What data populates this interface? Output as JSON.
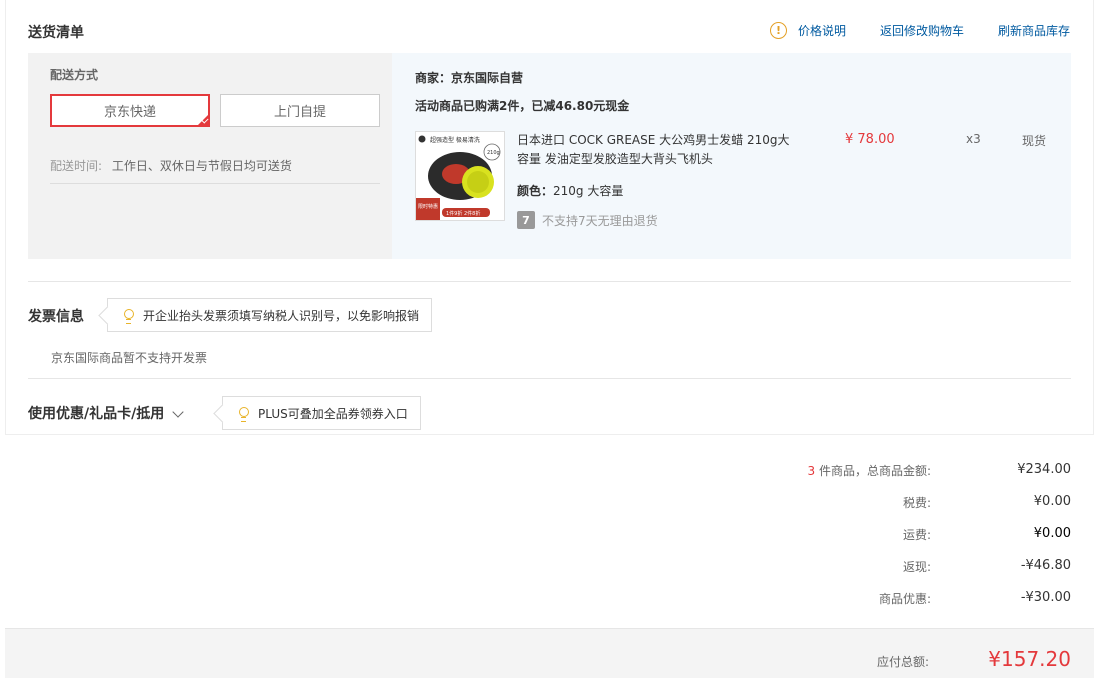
{
  "shipping": {
    "title": "送货清单",
    "links": {
      "price_note": "价格说明",
      "back_to_cart": "返回修改购物车",
      "refresh_stock": "刷新商品库存"
    },
    "delivery_method_label": "配送方式",
    "options": [
      "京东快递",
      "上门自提"
    ],
    "selected_option": "京东快递",
    "delivery_time_label": "配送时间:",
    "delivery_time_value": "工作日、双休日与节假日均可送货"
  },
  "order": {
    "merchant": "商家：京东国际自营",
    "promo": "活动商品已购满2件，已减46.80元现金",
    "product": {
      "name": "日本进口 COCK GREASE 大公鸡男士发蜡 210g大容量 发油定型发胶造型大背头飞机头",
      "price": "¥ 78.00",
      "quantity": "x3",
      "stock": "现货",
      "color_label": "颜色：",
      "color_value": "210g 大容量",
      "return_icon_text": "7",
      "return_policy": "不支持7天无理由退货",
      "image_texts": {
        "top": "超强造型 极易清洗",
        "weight": "210g",
        "badge": "限时特惠",
        "promo": "1件9折 2件8折"
      }
    }
  },
  "invoice": {
    "title": "发票信息",
    "tip": "开企业抬头发票须填写纳税人识别号，以免影响报销",
    "note": "京东国际商品暂不支持开发票"
  },
  "coupons": {
    "title": "使用优惠/礼品卡/抵用",
    "tip": "PLUS可叠加全品券领券入口"
  },
  "summary": {
    "count": "3",
    "count_suffix": "件商品，总商品金额:",
    "goods_total": "¥234.00",
    "tax_label": "税费:",
    "tax": "¥0.00",
    "shipping_label": "运费:",
    "shipping": "¥0.00",
    "cashback_label": "返现:",
    "cashback": "-¥46.80",
    "discount_label": "商品优惠:",
    "discount": "-¥30.00",
    "total_label": "应付总额:",
    "total": "¥157.20"
  },
  "colors": {
    "accent_red": "#e4393c",
    "link_blue": "#005aa0",
    "warn_yellow": "#e4a026"
  }
}
